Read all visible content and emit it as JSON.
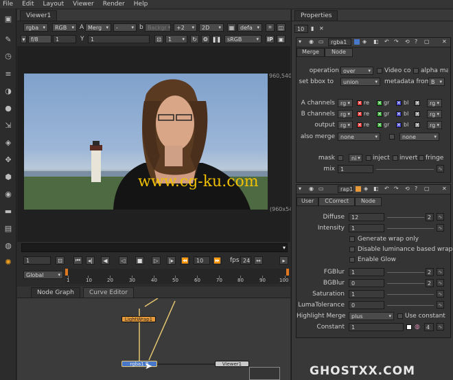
{
  "menu": [
    "File",
    "Edit",
    "Layout",
    "Viewer",
    "Render",
    "Help"
  ],
  "viewer": {
    "tab": "Viewer1",
    "channels": "rgba",
    "rgb": "RGB",
    "a_label": "A",
    "a_input": "Merg",
    "a_dash": "-",
    "b_label": "b",
    "b_input": "Backgr",
    "zoom_factor": "+2",
    "view_mode": "2D",
    "lut_input": "defa",
    "fstop": "f/8",
    "frame_field": "1",
    "y_label": "Y",
    "y_value": "1",
    "proxy": "1",
    "colorspace": "sRGB",
    "ip": "IP",
    "res_top": "960,540",
    "res_bottom": "(960x54",
    "watermark": "www.cg-ku.com",
    "frame_current": "1",
    "frame_step": "10",
    "fps_label": "fps",
    "fps_value": "24",
    "range_mode": "Global",
    "ruler": [
      "1",
      "10",
      "20",
      "30",
      "40",
      "50",
      "60",
      "70",
      "80",
      "90",
      "100"
    ]
  },
  "nodegraph": {
    "tabs": [
      "Node Graph",
      "Curve Editor"
    ],
    "nodes": {
      "lightwrap": "LightWrap1",
      "merge": "rgba1 B",
      "viewer": "Viewer1"
    }
  },
  "properties": {
    "tab": "Properties",
    "max_panels": "10",
    "merge": {
      "name": "rgba1",
      "tabs": [
        "Merge",
        "Node"
      ],
      "operation_label": "operation",
      "operation": "over",
      "videocolor": "Video co",
      "alpha_label": "alpha ma",
      "bbox_label": "set bbox to",
      "bbox": "union",
      "metadata_label": "metadata from",
      "metadata": "B",
      "a_channels_label": "A channels",
      "b_channels_label": "B channels",
      "output_label": "output",
      "also_merge_label": "also merge",
      "chan": "rg",
      "red": "re",
      "green": "gr",
      "blue": "bl",
      "alpha_dd": "rg",
      "also_merge": "none",
      "also_merge2": "none",
      "mask_label": "mask",
      "mask_input": "ni",
      "inject": "inject",
      "invert": "invert",
      "fringe": "fringe",
      "mix_label": "mix",
      "mix": "1"
    },
    "lightwrap": {
      "name": "rap1",
      "tabs": [
        "User",
        "CCorrect",
        "Node"
      ],
      "diffuse_label": "Diffuse",
      "diffuse": "12",
      "diffuse_max": "2",
      "intensity_label": "Intensity",
      "intensity": "1",
      "gen_wrap": "Generate wrap only",
      "disable_lum": "Disable luminance based wrap",
      "enable_glow": "Enable Glow",
      "fgblur_label": "FGBlur",
      "fgblur": "1",
      "fgblur_max": "2",
      "bgblur_label": "BGBlur",
      "bgblur": "0",
      "bgblur_max": "2",
      "saturation_label": "Saturation",
      "saturation": "1",
      "luma_label": "LumaTolerance",
      "luma": "0",
      "highlight_label": "Highlight Merge",
      "highlight": "plus",
      "use_constant": "Use constant",
      "constant_label": "Constant",
      "constant": "1",
      "constant_n": "4"
    }
  },
  "corner_watermark": "GHOSTXX.COM"
}
